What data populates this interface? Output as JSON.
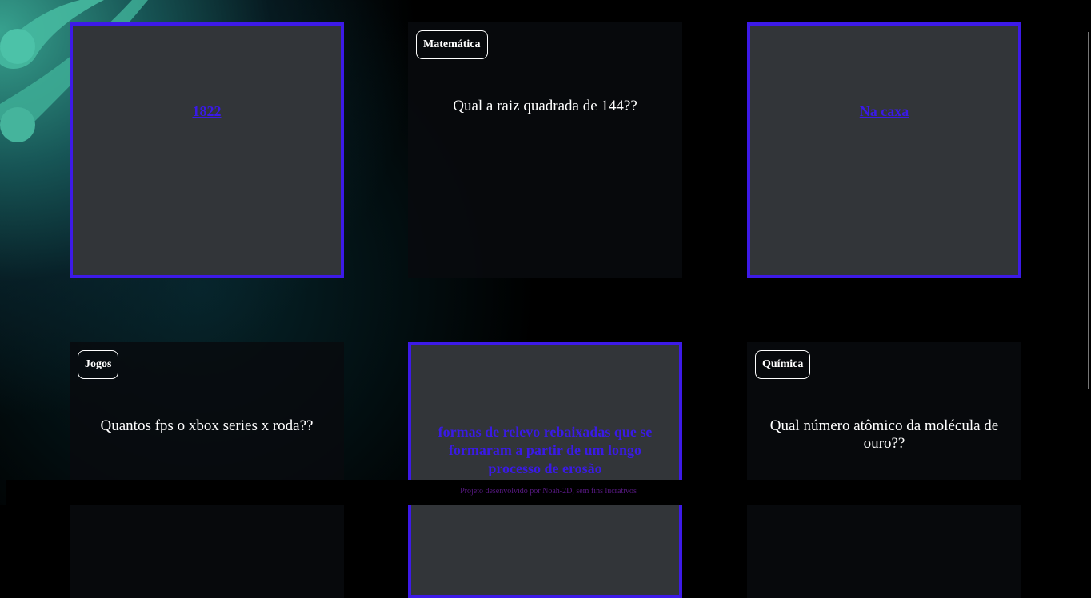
{
  "cards": [
    {
      "state": "answer",
      "answer": "1822"
    },
    {
      "state": "question",
      "category": "Matemática",
      "question": "Qual a raiz quadrada de 144??"
    },
    {
      "state": "answer",
      "answer": "Na caxa"
    },
    {
      "state": "question",
      "category": "Jogos",
      "question": "Quantos fps o xbox series x roda??"
    },
    {
      "state": "answer",
      "answer": "formas de relevo rebaixadas que se formaram a partir de um longo processo de erosão"
    },
    {
      "state": "question",
      "category": "Química",
      "question": "Qual número atômico da molécula de ouro??"
    }
  ],
  "footer": "Projeto desenvolvido por Noah-2D, sem fins lucrativos",
  "colors": {
    "accent": "#3d1ae8",
    "card_back": "#323539",
    "footer_text": "#5a1a86"
  }
}
